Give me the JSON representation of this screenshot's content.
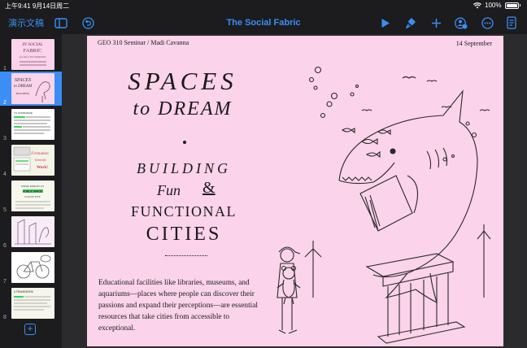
{
  "status": {
    "time": "上午9:41",
    "date": "9月14日周二",
    "battery": "100%"
  },
  "toolbar": {
    "presentations_label": "演示文稿",
    "title": "The Social Fabric"
  },
  "sidebar": {
    "slides": [
      {
        "number": "1",
        "lines": [
          "IN SOCIAL",
          "FABRIC",
          "A CALL TO CHANGE"
        ]
      },
      {
        "number": "2",
        "lines": [
          "SPACES",
          "to DREAM",
          "BUILDING"
        ]
      },
      {
        "number": "3",
        "lines": [
          "TO SUMMARIZE"
        ]
      },
      {
        "number": "4",
        "lines": [
          "Formation",
          "Gentrific",
          "Work!"
        ]
      },
      {
        "number": "5",
        "lines": [
          "WHAT MAKES US",
          "PUBLIC SPACE",
          "COLLECTIVE"
        ]
      },
      {
        "number": "6",
        "lines": [
          ""
        ]
      },
      {
        "number": "7",
        "lines": [
          ""
        ]
      },
      {
        "number": "8",
        "lines": [
          "A FRAMEWORK"
        ]
      }
    ]
  },
  "slide": {
    "header_left": "GEO 310 Seminar / Madi Cavanna",
    "header_right": "14 September",
    "title_line1": "SPACES",
    "title_line2": "to DREAM",
    "sub_building": "BUILDING",
    "sub_fun": "Fun",
    "sub_amp": "&",
    "sub_functional": "FUNCTIONAL",
    "sub_cities": "CITIES",
    "body": "Educational facilities like libraries, museums, and aquariums—places where people can discover their passions and expand their perceptions—are essential resources that take cities from accessible to exceptional."
  },
  "colors": {
    "accent": "#3a8ef6",
    "slide_bg": "#fbd3ea",
    "chrome": "#1c1c1e"
  }
}
